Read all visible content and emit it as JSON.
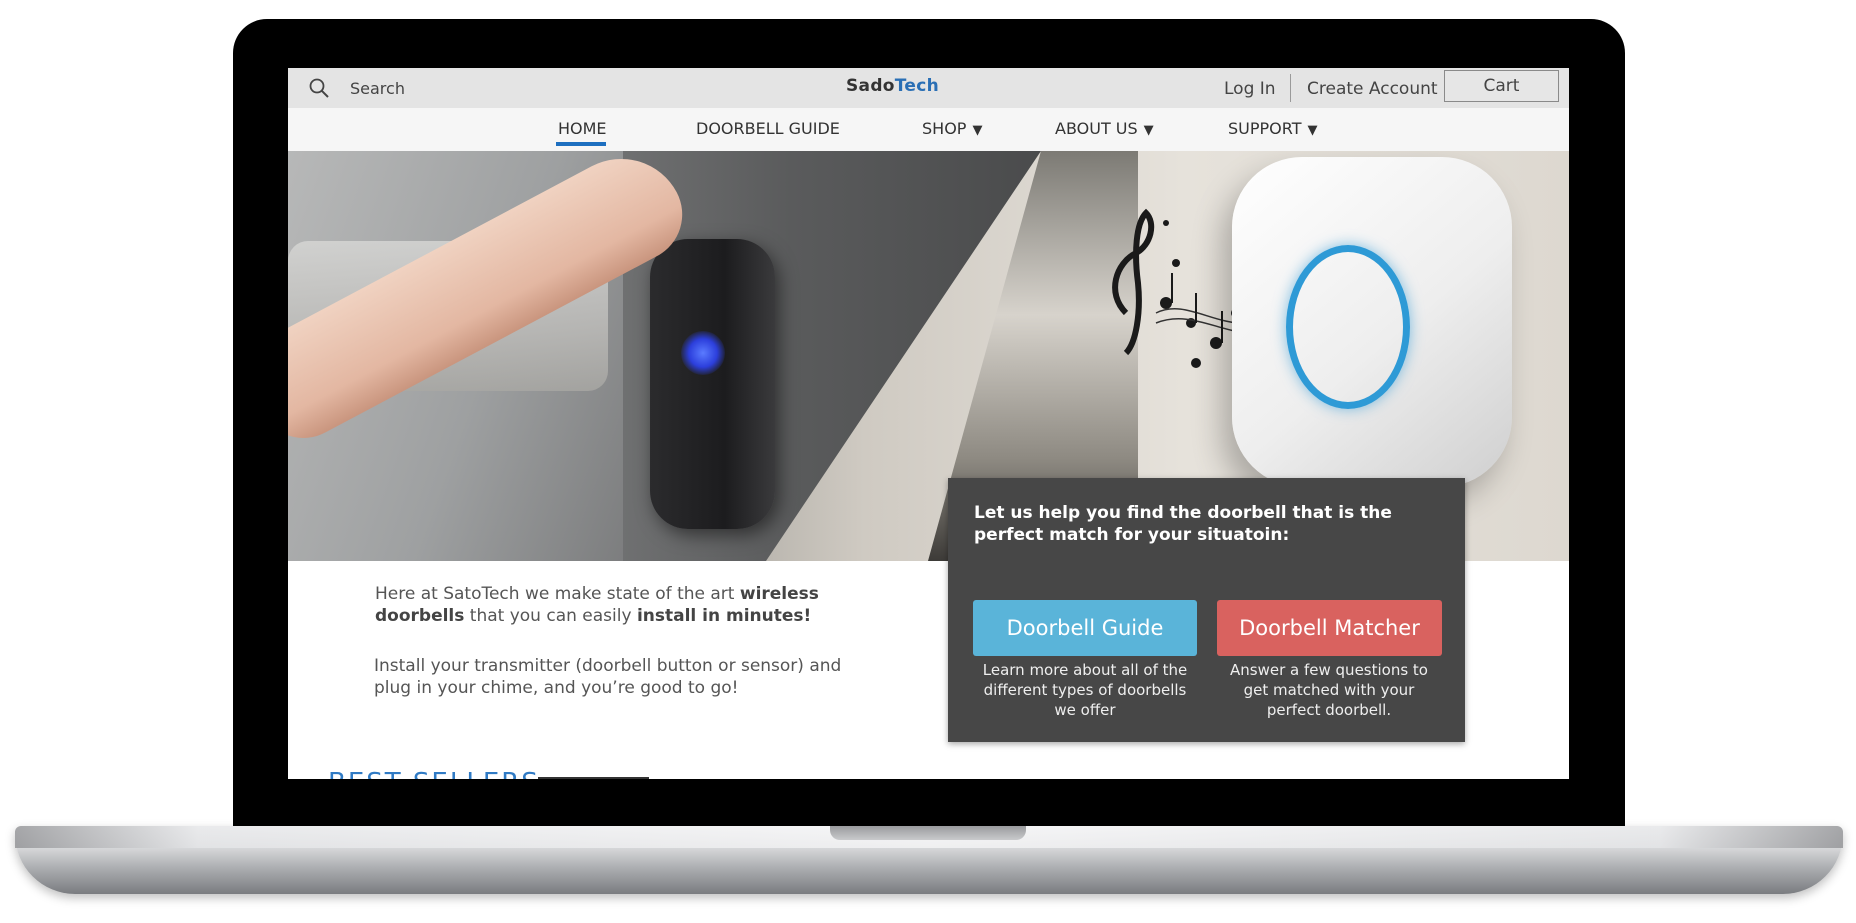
{
  "header": {
    "search_placeholder": "Search",
    "logo_part1": "Sado",
    "logo_part2": "Tech",
    "login": "Log In",
    "create_account": "Create Account",
    "cart": "Cart"
  },
  "nav": {
    "items": [
      {
        "label": "HOME",
        "active": true
      },
      {
        "label": "DOORBELL GUIDE"
      },
      {
        "label": "SHOP",
        "dropdown": true
      },
      {
        "label": "ABOUT US",
        "dropdown": true
      },
      {
        "label": "SUPPORT",
        "dropdown": true
      }
    ],
    "caret": "▼"
  },
  "finder": {
    "title": "Let us help you find the doorbell that is the perfect match for your situatoin:",
    "guide_button": "Doorbell Guide",
    "guide_desc": "Learn more about all of the different types of doorbells we offer",
    "matcher_button": "Doorbell Matcher",
    "matcher_desc": "Answer a few questions to get matched with your perfect doorbell."
  },
  "intro": {
    "p1_a": "Here at SatoTech we make state of the art ",
    "p1_b": "wireless doorbells",
    "p1_c": " that you can easily ",
    "p1_d": "install in  minutes!",
    "p2": "Install your transmitter (doorbell button or sensor) and plug in your chime, and you’re good to go!"
  },
  "best_sellers": "BEST SELLERS",
  "colors": {
    "accent": "#1d6fc0",
    "guide_button": "#5ab4d9",
    "matcher_button": "#d9625f",
    "finder_bg": "#474747"
  }
}
